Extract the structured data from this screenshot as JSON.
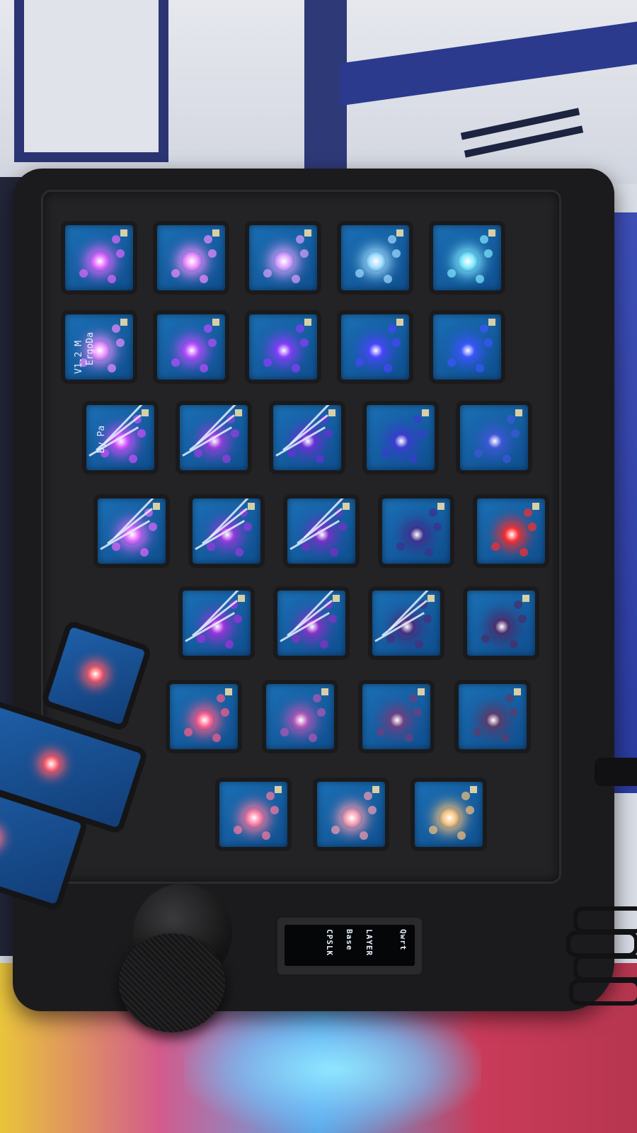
{
  "pcb_silkscreen": {
    "lines": [
      "ErgoDa",
      "V1.2 M",
      "By Pa"
    ]
  },
  "oled": {
    "lines": [
      "Qwrt",
      "LAYER",
      "Base",
      "CPSLK"
    ]
  },
  "colors": {
    "pcb": "#0f5ea8",
    "case": "#1b1b1d",
    "led_purple": "#d66bff",
    "led_blue": "#3f74ff",
    "led_red": "#ff3b3b",
    "led_pink": "#ff6f9a"
  },
  "rows": [
    {
      "leds": [
        "#e066ff",
        "#f08cff",
        "#d9a0ff",
        "#9fdcff",
        "#7fe8ff"
      ]
    },
    {
      "leds": [
        "#e98cff",
        "#b94dff",
        "#8b3cff",
        "#4a44ff",
        "#3b55ff"
      ]
    },
    {
      "leds": [
        "#d04dff",
        "#9d3ce0",
        "#6a2fd6",
        "#3b3bd0",
        "#3f57d8"
      ]
    },
    {
      "leds": [
        "#e066ff",
        "#9b38e0",
        "#7a2fc8",
        "#3e2f8c",
        "#ff2c2c"
      ]
    },
    {
      "leds": [
        "#a430e0",
        "#8a30c8",
        "#4a2c7e",
        "#4a2c6a"
      ]
    },
    {
      "leds": [
        "#ff5c8a",
        "#b457b8",
        "#6f3f80",
        "#5c3a6a"
      ]
    },
    {
      "leds": [
        "#ff7aa0",
        "#f59bb0",
        "#f7c07a"
      ]
    }
  ],
  "thumb_leds": [
    "#ff5c6a",
    "#ff5c6a",
    "#ff6f86"
  ]
}
